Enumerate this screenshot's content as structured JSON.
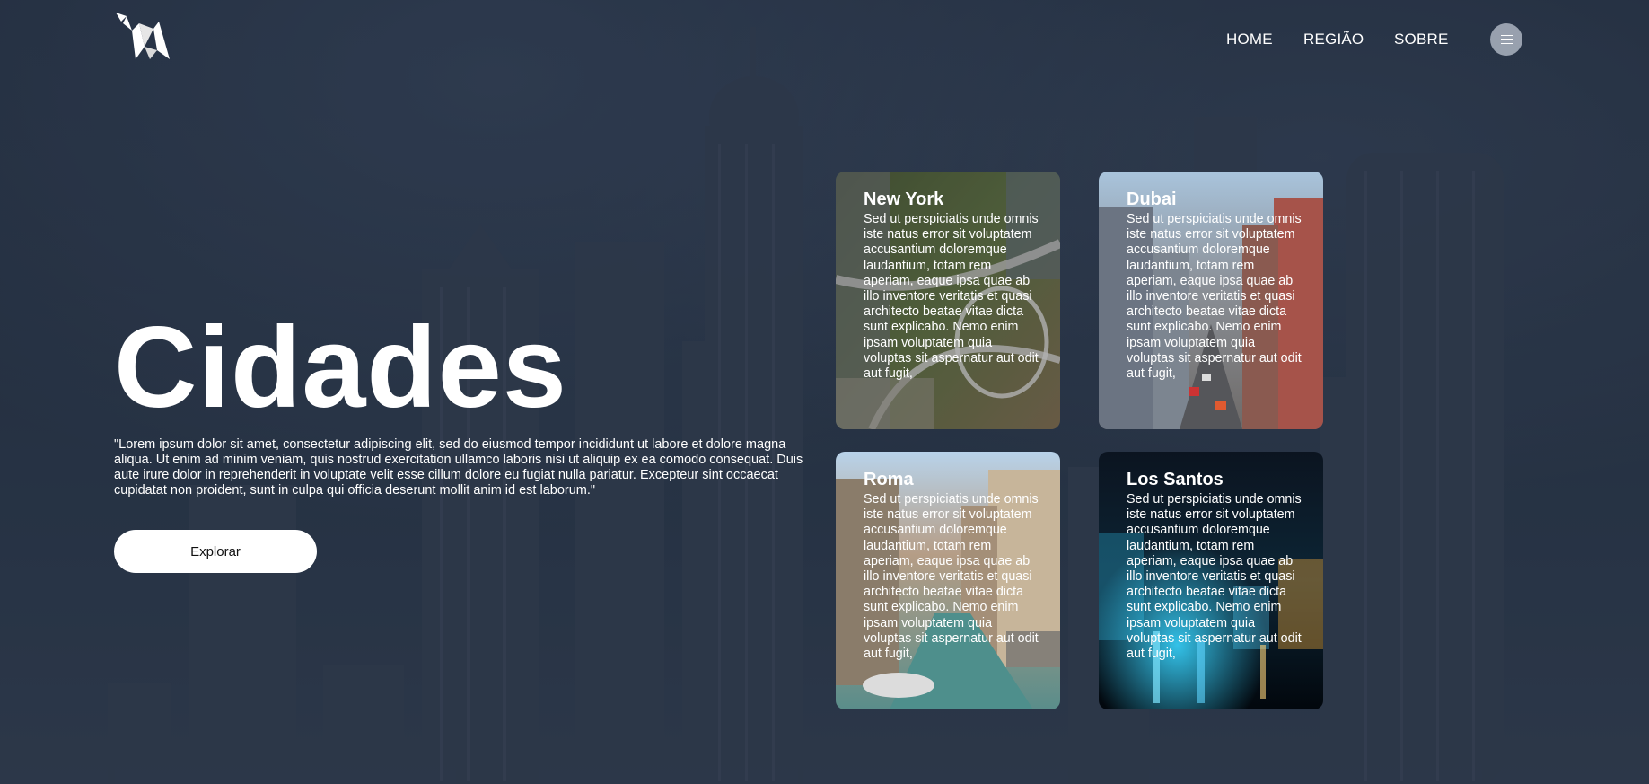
{
  "nav": {
    "items": [
      {
        "label": "HOME"
      },
      {
        "label": "REGIÃO"
      },
      {
        "label": "SOBRE"
      }
    ],
    "menu_icon": "hamburger-icon"
  },
  "logo": {
    "icon": "origami-bird-logo"
  },
  "hero": {
    "title": "Cidades",
    "quote": "\"Lorem ipsum dolor sit amet, consectetur adipiscing elit, sed do eiusmod tempor incididunt ut labore et dolore magna aliqua. Ut enim ad minim veniam, quis nostrud exercitation ullamco laboris nisi ut aliquip ex ea comodo consequat. Duis aute irure dolor in reprehenderit in voluptate velit esse cillum dolore eu fugiat nulla pariatur. Excepteur sint occaecat cupidatat non proident, sunt in culpa qui officia deserunt mollit anim id est laborum.\"",
    "button_label": "Explorar"
  },
  "cards": [
    {
      "title": "New York",
      "text": "Sed ut perspiciatis unde omnis iste natus error sit voluptatem accusantium doloremque laudantium, totam rem aperiam, eaque ipsa quae ab illo inventore veritatis et quasi architecto beatae vitae dicta sunt explicabo. Nemo enim ipsam voluptatem quia voluptas sit aspernatur aut odit aut fugit,"
    },
    {
      "title": "Dubai",
      "text": "Sed ut perspiciatis unde omnis iste natus error sit voluptatem accusantium doloremque laudantium, totam rem aperiam, eaque ipsa quae ab illo inventore veritatis et quasi architecto beatae vitae dicta sunt explicabo. Nemo enim ipsam voluptatem quia voluptas sit aspernatur aut odit aut fugit,"
    },
    {
      "title": "Roma",
      "text": "Sed ut perspiciatis unde omnis iste natus error sit voluptatem accusantium doloremque laudantium, totam rem aperiam, eaque ipsa quae ab illo inventore veritatis et quasi architecto beatae vitae dicta sunt explicabo. Nemo enim ipsam voluptatem quia voluptas sit aspernatur aut odit aut fugit,"
    },
    {
      "title": "Los Santos",
      "text": "Sed ut perspiciatis unde omnis iste natus error sit voluptatem accusantium doloremque laudantium, totam rem aperiam, eaque ipsa quae ab illo inventore veritatis et quasi architecto beatae vitae dicta sunt explicabo. Nemo enim ipsam voluptatem quia voluptas sit aspernatur aut odit aut fugit,"
    }
  ],
  "colors": {
    "text": "#ffffff",
    "button_bg": "#ffffff",
    "menu_button_bg": "#bec6d2"
  }
}
